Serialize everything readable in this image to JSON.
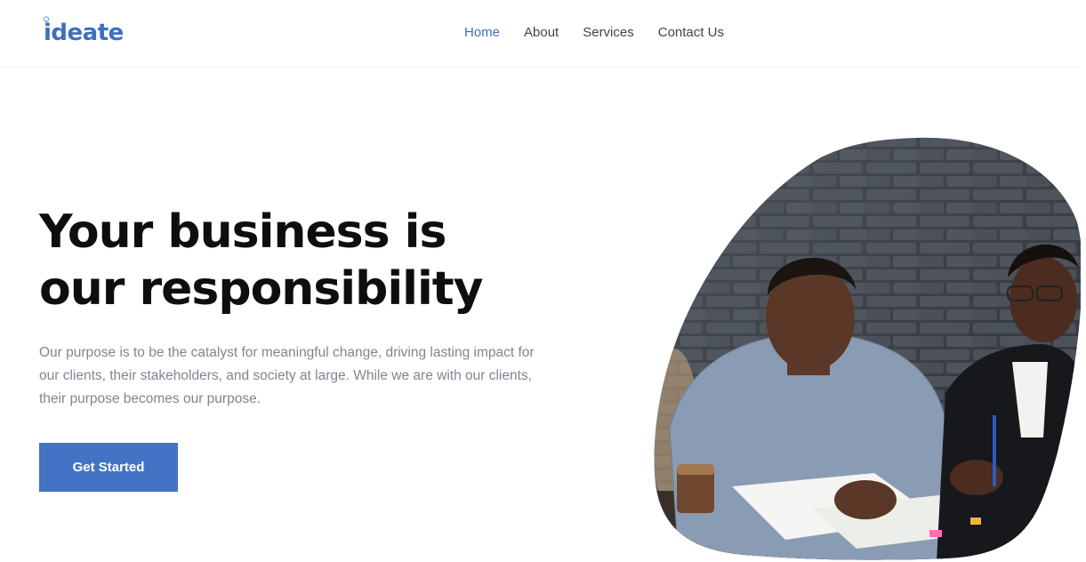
{
  "brand": {
    "name": "ideate",
    "color": "#3f6fbd"
  },
  "nav": {
    "items": [
      {
        "label": "Home",
        "active": true
      },
      {
        "label": "About",
        "active": false
      },
      {
        "label": "Services",
        "active": false
      },
      {
        "label": "Contact Us",
        "active": false
      }
    ]
  },
  "hero": {
    "title_line1": "Your business is",
    "title_line2": "our responsibility",
    "description": "Our purpose is to be the catalyst for meaningful change, driving lasting impact for our clients, their stakeholders, and society at large. While we are with our clients, their purpose becomes our purpose.",
    "cta_label": "Get Started",
    "cta_color": "#4473c5",
    "image_alt": "Two businessmen reviewing documents at a table",
    "image_icon": "photo-people-meeting"
  }
}
